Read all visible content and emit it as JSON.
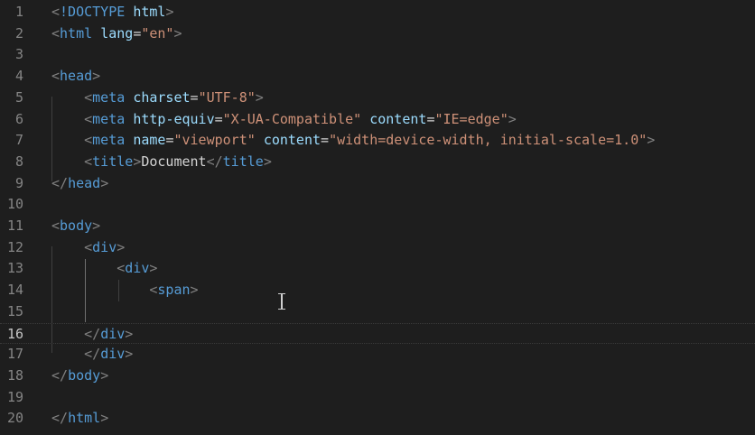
{
  "editor": {
    "language": "html",
    "current_line": 16,
    "lines": [
      {
        "n": "1",
        "tokens": [
          {
            "c": "tk-punct",
            "t": "<"
          },
          {
            "c": "tk-doctype",
            "t": "!DOCTYPE"
          },
          {
            "c": "tk-text",
            "t": " "
          },
          {
            "c": "tk-attr",
            "t": "html"
          },
          {
            "c": "tk-punct",
            "t": ">"
          }
        ]
      },
      {
        "n": "2",
        "tokens": [
          {
            "c": "tk-punct",
            "t": "<"
          },
          {
            "c": "tk-tag",
            "t": "html"
          },
          {
            "c": "tk-text",
            "t": " "
          },
          {
            "c": "tk-attr",
            "t": "lang"
          },
          {
            "c": "tk-text",
            "t": "="
          },
          {
            "c": "tk-str",
            "t": "\"en\""
          },
          {
            "c": "tk-punct",
            "t": ">"
          }
        ]
      },
      {
        "n": "3",
        "tokens": []
      },
      {
        "n": "4",
        "tokens": [
          {
            "c": "tk-punct",
            "t": "<"
          },
          {
            "c": "tk-tag",
            "t": "head"
          },
          {
            "c": "tk-punct",
            "t": ">"
          }
        ]
      },
      {
        "n": "5",
        "tokens": [
          {
            "c": "tk-text",
            "t": "    "
          },
          {
            "c": "tk-punct",
            "t": "<"
          },
          {
            "c": "tk-tag",
            "t": "meta"
          },
          {
            "c": "tk-text",
            "t": " "
          },
          {
            "c": "tk-attr",
            "t": "charset"
          },
          {
            "c": "tk-text",
            "t": "="
          },
          {
            "c": "tk-str",
            "t": "\"UTF-8\""
          },
          {
            "c": "tk-punct",
            "t": ">"
          }
        ]
      },
      {
        "n": "6",
        "tokens": [
          {
            "c": "tk-text",
            "t": "    "
          },
          {
            "c": "tk-punct",
            "t": "<"
          },
          {
            "c": "tk-tag",
            "t": "meta"
          },
          {
            "c": "tk-text",
            "t": " "
          },
          {
            "c": "tk-attr",
            "t": "http-equiv"
          },
          {
            "c": "tk-text",
            "t": "="
          },
          {
            "c": "tk-str",
            "t": "\"X-UA-Compatible\""
          },
          {
            "c": "tk-text",
            "t": " "
          },
          {
            "c": "tk-attr",
            "t": "content"
          },
          {
            "c": "tk-text",
            "t": "="
          },
          {
            "c": "tk-str",
            "t": "\"IE=edge\""
          },
          {
            "c": "tk-punct",
            "t": ">"
          }
        ]
      },
      {
        "n": "7",
        "tokens": [
          {
            "c": "tk-text",
            "t": "    "
          },
          {
            "c": "tk-punct",
            "t": "<"
          },
          {
            "c": "tk-tag",
            "t": "meta"
          },
          {
            "c": "tk-text",
            "t": " "
          },
          {
            "c": "tk-attr",
            "t": "name"
          },
          {
            "c": "tk-text",
            "t": "="
          },
          {
            "c": "tk-str",
            "t": "\"viewport\""
          },
          {
            "c": "tk-text",
            "t": " "
          },
          {
            "c": "tk-attr",
            "t": "content"
          },
          {
            "c": "tk-text",
            "t": "="
          },
          {
            "c": "tk-str",
            "t": "\"width=device-width, initial-scale=1.0\""
          },
          {
            "c": "tk-punct",
            "t": ">"
          }
        ]
      },
      {
        "n": "8",
        "tokens": [
          {
            "c": "tk-text",
            "t": "    "
          },
          {
            "c": "tk-punct",
            "t": "<"
          },
          {
            "c": "tk-tag",
            "t": "title"
          },
          {
            "c": "tk-punct",
            "t": ">"
          },
          {
            "c": "tk-text",
            "t": "Document"
          },
          {
            "c": "tk-punct",
            "t": "</"
          },
          {
            "c": "tk-tag",
            "t": "title"
          },
          {
            "c": "tk-punct",
            "t": ">"
          }
        ]
      },
      {
        "n": "9",
        "tokens": [
          {
            "c": "tk-punct",
            "t": "</"
          },
          {
            "c": "tk-tag",
            "t": "head"
          },
          {
            "c": "tk-punct",
            "t": ">"
          }
        ]
      },
      {
        "n": "10",
        "tokens": []
      },
      {
        "n": "11",
        "tokens": [
          {
            "c": "tk-punct",
            "t": "<"
          },
          {
            "c": "tk-tag",
            "t": "body"
          },
          {
            "c": "tk-punct",
            "t": ">"
          }
        ]
      },
      {
        "n": "12",
        "tokens": [
          {
            "c": "tk-text",
            "t": "    "
          },
          {
            "c": "tk-punct",
            "t": "<"
          },
          {
            "c": "tk-tag",
            "t": "div"
          },
          {
            "c": "tk-punct",
            "t": ">"
          }
        ]
      },
      {
        "n": "13",
        "tokens": [
          {
            "c": "tk-text",
            "t": "        "
          },
          {
            "c": "tk-punct",
            "t": "<"
          },
          {
            "c": "tk-tag",
            "t": "div"
          },
          {
            "c": "tk-punct",
            "t": ">"
          }
        ]
      },
      {
        "n": "14",
        "tokens": [
          {
            "c": "tk-text",
            "t": "            "
          },
          {
            "c": "tk-punct",
            "t": "<"
          },
          {
            "c": "tk-tag",
            "t": "span"
          },
          {
            "c": "tk-punct",
            "t": ">"
          }
        ]
      },
      {
        "n": "15",
        "tokens": []
      },
      {
        "n": "16",
        "tokens": [
          {
            "c": "tk-text",
            "t": "    "
          },
          {
            "c": "tk-punct",
            "t": "</"
          },
          {
            "c": "tk-tag",
            "t": "div"
          },
          {
            "c": "tk-punct",
            "t": ">"
          }
        ]
      },
      {
        "n": "17",
        "tokens": [
          {
            "c": "tk-text",
            "t": "    "
          },
          {
            "c": "tk-punct",
            "t": "</"
          },
          {
            "c": "tk-tag",
            "t": "div"
          },
          {
            "c": "tk-punct",
            "t": ">"
          }
        ]
      },
      {
        "n": "18",
        "tokens": [
          {
            "c": "tk-punct",
            "t": "</"
          },
          {
            "c": "tk-tag",
            "t": "body"
          },
          {
            "c": "tk-punct",
            "t": ">"
          }
        ]
      },
      {
        "n": "19",
        "tokens": []
      },
      {
        "n": "20",
        "tokens": [
          {
            "c": "tk-punct",
            "t": "</"
          },
          {
            "c": "tk-tag",
            "t": "html"
          },
          {
            "c": "tk-punct",
            "t": ">"
          }
        ]
      }
    ]
  }
}
